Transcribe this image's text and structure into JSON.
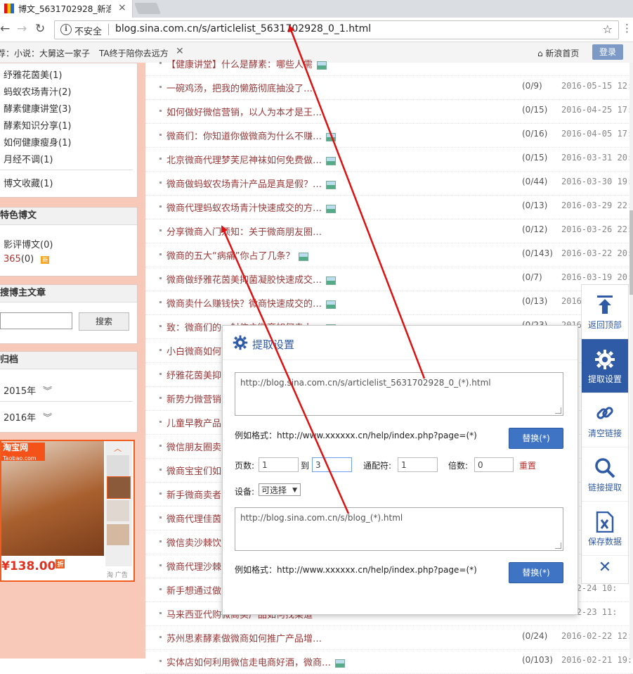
{
  "browser": {
    "tab_title": "博文_5631702928_新浪",
    "tab_close": "×",
    "insecure_label": "不安全",
    "url": "blog.sina.com.cn/s/articlelist_5631702928_0_1.html"
  },
  "sinabar": {
    "hot_prefix": "荐：小说：大舅这一家子",
    "hot2": "TA终于陪你去远方",
    "home_label": "⌂ 新浪首页",
    "login_label": "登录"
  },
  "sidebar": {
    "categories": [
      {
        "label": "纾雅花茵美",
        "count": "(1)"
      },
      {
        "label": "蚂蚁农场青汁",
        "count": "(2)"
      },
      {
        "label": "酵素健康讲堂",
        "count": "(3)"
      },
      {
        "label": "酵素知识分享",
        "count": "(1)"
      },
      {
        "label": "如何健康瘦身",
        "count": "(1)"
      },
      {
        "label": "月经不调",
        "count": "(1)"
      }
    ],
    "favorites": {
      "label": "博文收藏",
      "count": "(1)"
    },
    "featured_title": "特色博文",
    "featured": [
      {
        "label": "影评博文",
        "count": "(0)"
      },
      {
        "label": "365",
        "count": "(0)",
        "badge": "新"
      }
    ],
    "search_title": "搜博主文章",
    "search_button": "搜索",
    "archive_title": "归档",
    "archives": [
      "2015年",
      "2016年"
    ],
    "archive_chevron": "»",
    "ad": {
      "logo": "淘宝网",
      "logo_sub": "Taobao.com",
      "price": "¥138.00",
      "zhe": "折",
      "label": "淘 广告"
    }
  },
  "articles": [
    {
      "title": "【健康讲堂】什么是酵素：哪些人需",
      "count": "",
      "date": "",
      "img": true
    },
    {
      "title": "一碗鸡汤，把我的懒筋彻底抽没了…",
      "count": "(0/9)",
      "date": "2016-05-15 12:",
      "img": false
    },
    {
      "title": "如何做好微信营销，以人为本才是王…",
      "count": "(0/15)",
      "date": "2016-04-25 17:",
      "img": false
    },
    {
      "title": "微商们：你知道你做微商为什么不赚…",
      "count": "(0/16)",
      "date": "2016-04-05 17:",
      "img": true
    },
    {
      "title": "北京微商代理梦芙尼神袜如何免费做…",
      "count": "(0/15)",
      "date": "2016-03-31 20:",
      "img": true
    },
    {
      "title": "微商做蚂蚁农场青汁产品是真是假？…",
      "count": "(0/44)",
      "date": "2016-03-30 19:",
      "img": true
    },
    {
      "title": "微商代理蚂蚁农场青汁快速成交的方…",
      "count": "(0/13)",
      "date": "2016-03-29 22:",
      "img": true
    },
    {
      "title": "分享微商入门须知：关于微商朋友圈…",
      "count": "(0/12)",
      "date": "2016-03-26 22:",
      "img": false
    },
    {
      "title": "微商的五大“病痛”你占了几条？",
      "count": "(0/143)",
      "date": "2016-03-22 20:",
      "img": true
    },
    {
      "title": "微商做纾雅花茵美抑菌凝胶快速成交…",
      "count": "(0/7)",
      "date": "2016-03-19 20:",
      "img": true
    },
    {
      "title": "微商卖什么赚钱快？微商快速成交的…",
      "count": "(0/13)",
      "date": "2016",
      "img": true
    },
    {
      "title": "致：微商们的一封信之微商如何走上…",
      "count": "(0/23)",
      "date": "2016",
      "img": true
    },
    {
      "title": "小白微商如何",
      "count": "",
      "date": "",
      "img": false
    },
    {
      "title": "纾雅花茵美抑",
      "count": "",
      "date": "",
      "img": false
    },
    {
      "title": "新势力微营销",
      "count": "",
      "date": "",
      "img": false
    },
    {
      "title": "儿童早教产品",
      "count": "",
      "date": "",
      "img": false
    },
    {
      "title": "微信朋友圈卖",
      "count": "",
      "date": "",
      "img": false
    },
    {
      "title": "微商宝宝们如",
      "count": "",
      "date": "",
      "img": false
    },
    {
      "title": "新手微商卖者",
      "count": "",
      "date": "",
      "img": false
    },
    {
      "title": "微商代理佳茵",
      "count": "",
      "date": "",
      "img": false
    },
    {
      "title": "微信卖沙棘饮",
      "count": "",
      "date": "",
      "img": false
    },
    {
      "title": "微商代理沙棘",
      "count": "",
      "date": "",
      "img": false
    },
    {
      "title": "新手想通过做",
      "count": "",
      "date": "6-02-24 10:",
      "img": false
    },
    {
      "title": "马来西亚代购微商卖产品如何找渠道",
      "count": "",
      "date": "6-02-23 11:",
      "img": false
    },
    {
      "title": "苏州思素酵素做微商如何推广产品增…",
      "count": "(0/24)",
      "date": "2016-02-22 12:",
      "img": false
    },
    {
      "title": "实体店如何利用微信走电商好酒，微商…",
      "count": "(0/103)",
      "date": "2016-02-21 19:",
      "img": true
    }
  ],
  "float_toolbar": {
    "back_top": "返回顶部",
    "extract_settings": "提取设置",
    "clear_links": "清空链接",
    "extract_links": "链接提取",
    "save_data": "保存数据",
    "close": "✕"
  },
  "dialog": {
    "title": "提取设置",
    "url_pattern_1": "http://blog.sina.com.cn/s/articlelist_5631702928_0_(*).html",
    "example_1": "例如格式：http://www.xxxxxx.cn/help/index.php?page=(*)",
    "replace_label": "替换(*)",
    "pages_label": "页数:",
    "pages_from": "1",
    "to_label": "到",
    "pages_to": "3",
    "wildcard_label": "通配符:",
    "wildcard_value": "1",
    "multiple_label": "倍数:",
    "multiple_value": "0",
    "reset_label": "重置",
    "device_label": "设备:",
    "device_value": "可选择",
    "url_pattern_2": "http://blog.sina.com.cn/s/blog_(*).html",
    "example_2": "例如格式：http://www.xxxxxx.cn/help/index.php?page=(*)"
  },
  "colors": {
    "accent": "#2e5aa6",
    "annotation_arrow": "#e01010",
    "sidebar_bg": "#f8c8b8",
    "article_link": "#993a3a"
  }
}
